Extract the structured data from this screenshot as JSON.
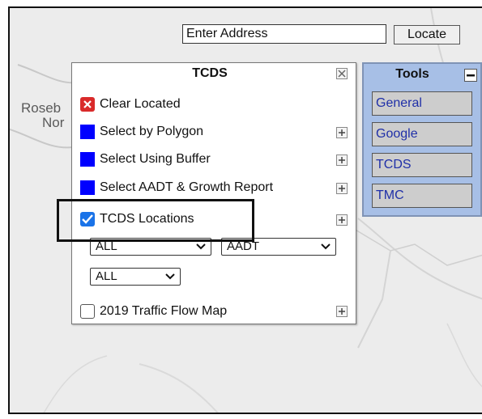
{
  "map": {
    "place_1": "Roseb",
    "place_2": "Nor"
  },
  "address_bar": {
    "value": "Enter Address",
    "locate_label": "Locate"
  },
  "tcds_panel": {
    "title": "TCDS",
    "items": [
      {
        "label": "Clear Located",
        "icon": "red-x-icon"
      },
      {
        "label": "Select by Polygon",
        "icon": "blue-square-icon"
      },
      {
        "label": "Select Using Buffer",
        "icon": "blue-square-icon"
      },
      {
        "label": "Select AADT & Growth Report",
        "icon": "blue-square-icon"
      },
      {
        "label": "TCDS Locations",
        "icon": "checkbox",
        "checked": true
      },
      {
        "label": "2019 Traffic Flow Map",
        "icon": "checkbox",
        "checked": false
      }
    ],
    "filters": {
      "filter_1": "ALL",
      "filter_2": "AADT",
      "filter_3": "ALL"
    }
  },
  "tools_panel": {
    "title": "Tools",
    "buttons": [
      "General",
      "Google",
      "TCDS",
      "TMC"
    ]
  },
  "colors": {
    "blue_square": "#0000ff",
    "clear_red": "#d92a2a",
    "checkbox_blue": "#1a73e8",
    "tools_bg": "#a7bfe6",
    "tool_text": "#1f2fa8"
  }
}
